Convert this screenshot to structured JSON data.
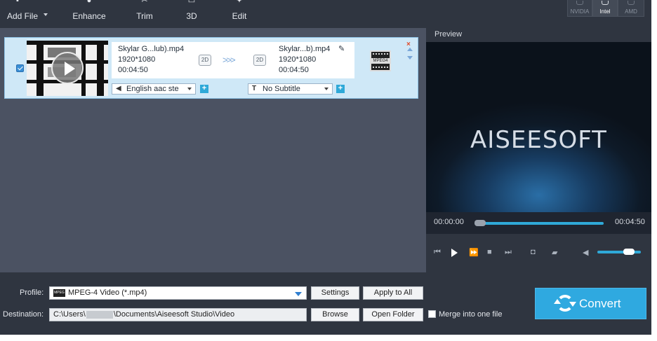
{
  "toolbar": {
    "add_file": "Add File",
    "enhance": "Enhance",
    "trim": "Trim",
    "three_d": "3D",
    "edit": "Edit"
  },
  "accelerators": {
    "nvidia": "NVIDIA",
    "intel": "Intel",
    "amd": "AMD"
  },
  "file_row": {
    "source": {
      "name": "Skylar G...lub).mp4",
      "resolution": "1920*1080",
      "duration": "00:04:50",
      "badge": "2D"
    },
    "output": {
      "name": "Skylar...b).mp4",
      "resolution": "1920*1080",
      "duration": "00:04:50",
      "badge": "2D"
    },
    "arrows": ">>>",
    "audio_track": "English aac ste",
    "subtitle": "No Subtitle",
    "format_badge": "MPEG4",
    "close": "×",
    "checked": true
  },
  "preview": {
    "label": "Preview",
    "brand": "AISEESOFT",
    "time_current": "00:00:00",
    "time_total": "00:04:50",
    "seek_fraction": 0.0,
    "volume_fraction": 0.8
  },
  "bottom": {
    "profile_label": "Profile:",
    "profile_value": "MPEG-4 Video (*.mp4)",
    "profile_icon_text": "MPEG",
    "settings": "Settings",
    "apply_to_all": "Apply to All",
    "destination_label": "Destination:",
    "destination_prefix": "C:\\Users\\",
    "destination_suffix": "\\Documents\\Aiseesoft Studio\\Video",
    "browse": "Browse",
    "open_folder": "Open Folder",
    "merge_label": "Merge into one file",
    "convert": "Convert"
  },
  "colors": {
    "toolbar_bg": "#2f3540",
    "list_bg": "#4b5262",
    "row_bg": "#cfe8f7",
    "accent": "#2fa9e0"
  }
}
